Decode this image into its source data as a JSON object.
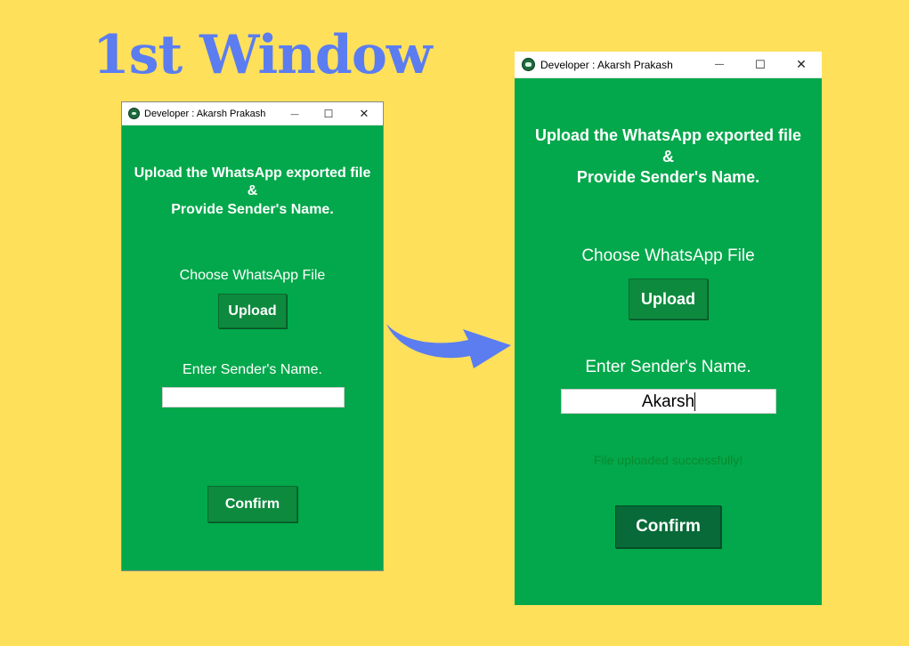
{
  "page_heading": "1st Window",
  "colors": {
    "background": "#fee05b",
    "heading": "#5b7df0",
    "window_bg": "#02a84b",
    "button_bg": "#0d8a3e",
    "confirm_active_bg": "#076a38",
    "status_text": "#0a8a2f",
    "arrow": "#5b7df0"
  },
  "window_1": {
    "titlebar": {
      "title": "Developer : Akarsh Prakash",
      "minimize": "—",
      "maximize": "☐",
      "close": "✕"
    },
    "header_line1": "Upload the WhatsApp exported file",
    "header_line2": "&",
    "header_line3": "Provide Sender's Name.",
    "choose_label": "Choose WhatsApp File",
    "upload_button": "Upload",
    "sender_label": "Enter Sender's Name.",
    "sender_value": "",
    "confirm_button": "Confirm"
  },
  "window_2": {
    "titlebar": {
      "title": "Developer : Akarsh Prakash",
      "minimize": "—",
      "maximize": "☐",
      "close": "✕"
    },
    "header_line1": "Upload the WhatsApp exported file",
    "header_line2": "&",
    "header_line3": "Provide Sender's Name.",
    "choose_label": "Choose WhatsApp File",
    "upload_button": "Upload",
    "sender_label": "Enter Sender's Name.",
    "sender_value": "Akarsh",
    "status_message": "File uploaded successfully!",
    "confirm_button": "Confirm"
  }
}
